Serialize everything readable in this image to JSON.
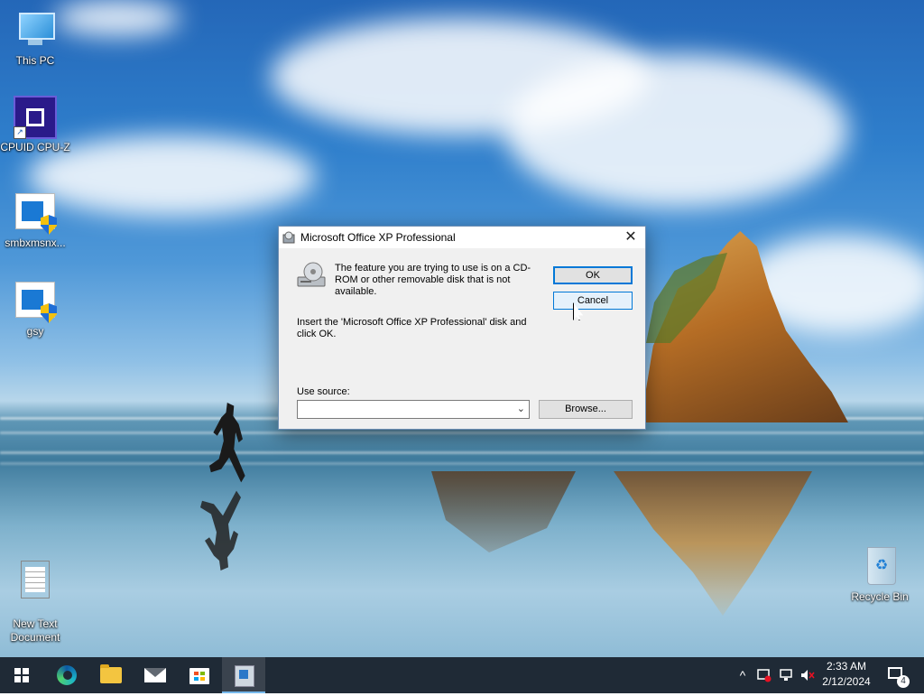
{
  "desktop": {
    "icons": [
      {
        "label": "This PC"
      },
      {
        "label": "CPUID CPU-Z"
      },
      {
        "label": "smbxmsnx..."
      },
      {
        "label": "gsy"
      },
      {
        "label": "New Text\nDocument"
      },
      {
        "label": "Recycle Bin"
      }
    ]
  },
  "dialog": {
    "title": "Microsoft Office XP Professional",
    "close_glyph": "✕",
    "message_line1": "The feature you are trying to use is on a CD-ROM or other removable disk that is not available.",
    "message_line2": "Insert the 'Microsoft Office XP Professional' disk and click OK.",
    "ok_label": "OK",
    "cancel_label": "Cancel",
    "source_label": "Use source:",
    "source_value": "",
    "browse_label": "Browse..."
  },
  "taskbar": {
    "apps": [
      "start",
      "edge",
      "file-explorer",
      "mail",
      "store",
      "setup"
    ],
    "clock_time": "2:33 AM",
    "clock_date": "2/12/2024",
    "notification_count": "4",
    "tray_chevron": "^"
  },
  "colors": {
    "accent": "#0078d7",
    "taskbar_bg": "#1f2a36"
  }
}
